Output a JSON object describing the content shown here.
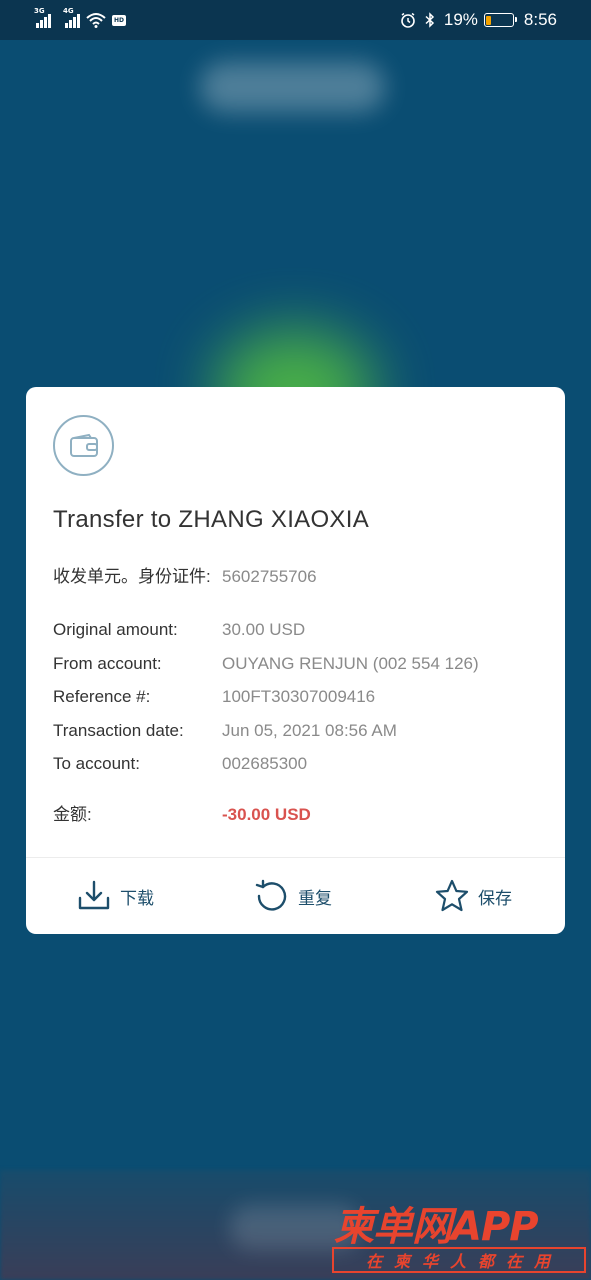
{
  "status_bar": {
    "signal1_label": "3G",
    "signal2_label": "4G",
    "battery_percent": "19%",
    "battery_level": 0.19,
    "time": "8:56"
  },
  "watermark": {
    "logo": "柬单网APP",
    "slogan": "在柬华人都在用"
  },
  "dialog": {
    "title": "Transfer to ZHANG XIAOXIA",
    "rows": [
      {
        "label": "收发单元。身份证件:",
        "value": "5602755706"
      },
      {
        "label": "Original amount:",
        "value": "30.00 USD"
      },
      {
        "label": "From account:",
        "value": "OUYANG RENJUN (002 554 126)"
      },
      {
        "label": "Reference #:",
        "value": "100FT30307009416"
      },
      {
        "label": "Transaction date:",
        "value": "Jun 05, 2021 08:56 AM"
      },
      {
        "label": "To account:",
        "value": "002685300"
      }
    ],
    "amount": {
      "label": "金额:",
      "value": "-30.00 USD"
    },
    "actions": {
      "download": "下载",
      "repeat": "重复",
      "save": "保存"
    }
  },
  "colors": {
    "background": "#0a4d72",
    "status_bar": "#0b3550",
    "accent": "#1d4e6b",
    "amount_negative": "#d9534f",
    "battery_low": "#f5a300",
    "watermark": "#e8442e"
  },
  "icons": [
    "signal-icon",
    "wifi-icon",
    "hd-icon",
    "alarm-icon",
    "bluetooth-icon",
    "battery-icon",
    "wallet-icon",
    "download-icon",
    "repeat-icon",
    "star-icon"
  ]
}
